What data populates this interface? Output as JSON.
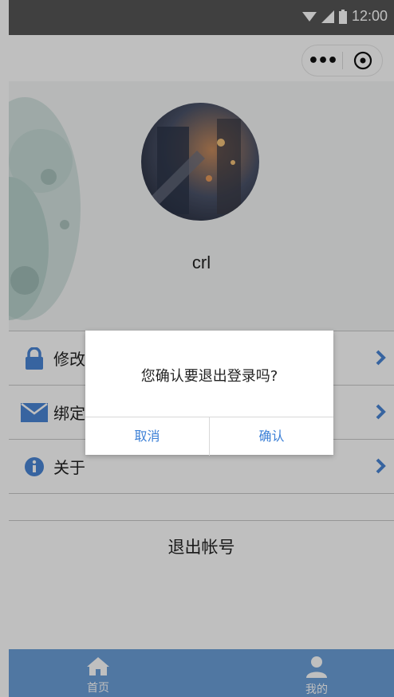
{
  "status_bar": {
    "time": "12:00"
  },
  "profile": {
    "username": "crl"
  },
  "menu": [
    {
      "label": "修改密码",
      "icon": "lock-icon"
    },
    {
      "label": "绑定邮箱",
      "icon": "mail-icon"
    },
    {
      "label": "关于",
      "icon": "info-icon"
    }
  ],
  "logout_label": "退出帐号",
  "dialog": {
    "message": "您确认要退出登录吗?",
    "cancel_label": "取消",
    "confirm_label": "确认"
  },
  "tabbar": {
    "items": [
      {
        "label": "首页",
        "icon": "home-icon"
      },
      {
        "label": "我的",
        "icon": "user-icon"
      }
    ]
  },
  "colors": {
    "accent": "#3b7fd6",
    "tabbar": "#6b9fd9",
    "menu_icon": "#4a86d6"
  }
}
